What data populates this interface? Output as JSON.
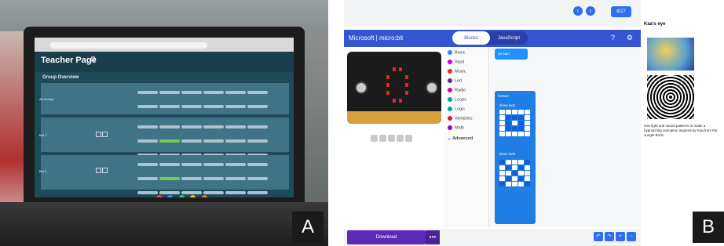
{
  "panel_labels": {
    "a": "A",
    "b": "B"
  },
  "teacher_page": {
    "title": "Teacher Page",
    "section_title": "Group Overview",
    "groups": [
      {
        "label": "All Groups"
      },
      {
        "label": "Bot 1"
      },
      {
        "label": "Bot 2"
      }
    ]
  },
  "makecode": {
    "step_counter": "8/27",
    "brand": "Microsoft | micro:bit",
    "tabs": {
      "blocks": "Blocks",
      "javascript": "JavaScript"
    },
    "toolbox": [
      "Basic",
      "Input",
      "Music",
      "Led",
      "Radio",
      "Loops",
      "Logic",
      "Variables",
      "Math",
      "Advanced"
    ],
    "toolbox_colors": [
      "#1e90ff",
      "#d400d4",
      "#e63022",
      "#5c2d91",
      "#e3008c",
      "#00a4a6",
      "#00a4a6",
      "#dc143c",
      "#9400d3",
      "#333333"
    ],
    "blocks": {
      "on_start": "on start",
      "forever": "forever",
      "show_leds_1": "show leds",
      "show_leds_2": "show leds"
    },
    "download_label": "Download",
    "more_label": "•••"
  },
  "tutorial": {
    "title": "Kaa's eye",
    "description": "Use light and sound patterns to make a hypnotizing animation inspired by Kaa from the Jungle Book."
  }
}
